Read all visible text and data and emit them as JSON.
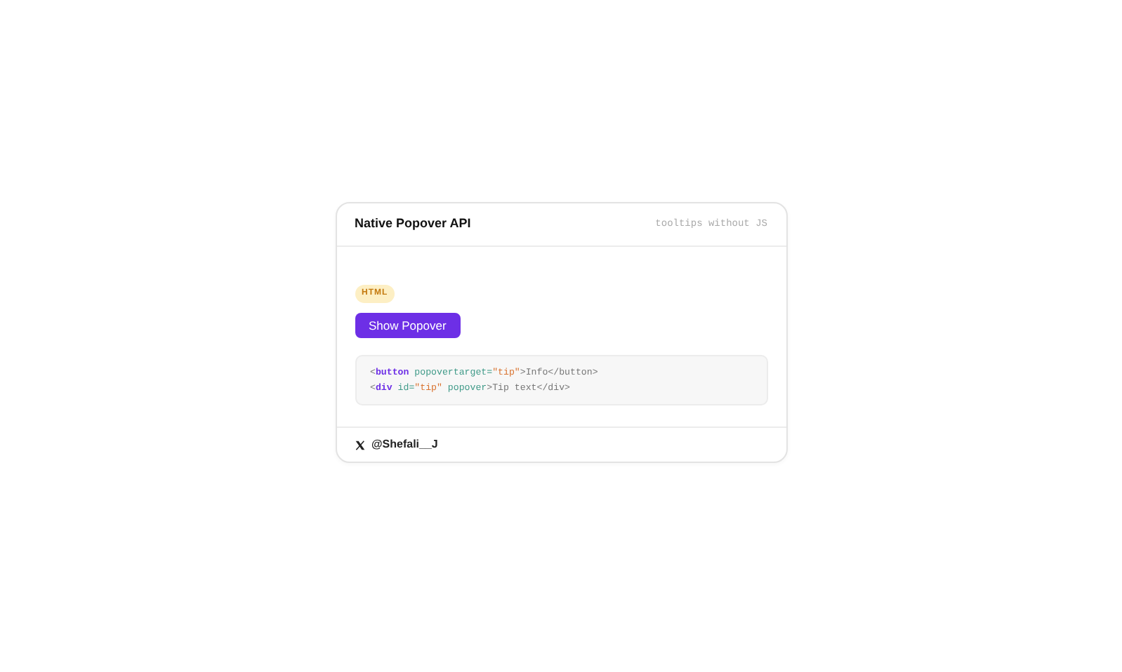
{
  "card": {
    "title": "Native Popover API",
    "subtitle": "tooltips without JS",
    "badge": "HTML",
    "button": "Show Popover",
    "code_lines": [
      [
        {
          "kind": "punct",
          "text": "<"
        },
        {
          "kind": "tag",
          "text": "button"
        },
        {
          "kind": "attr",
          "text": " popovertarget="
        },
        {
          "kind": "string",
          "text": "\"tip\""
        },
        {
          "kind": "punct",
          "text": ">Info</button>"
        }
      ],
      [
        {
          "kind": "punct",
          "text": "<"
        },
        {
          "kind": "tag",
          "text": "div"
        },
        {
          "kind": "attr",
          "text": " id="
        },
        {
          "kind": "string",
          "text": "\"tip\""
        },
        {
          "kind": "attr",
          "text": " popover"
        },
        {
          "kind": "punct",
          "text": ">Tip text</div>"
        }
      ]
    ],
    "footer": {
      "handle": "@Shefali__J"
    }
  }
}
